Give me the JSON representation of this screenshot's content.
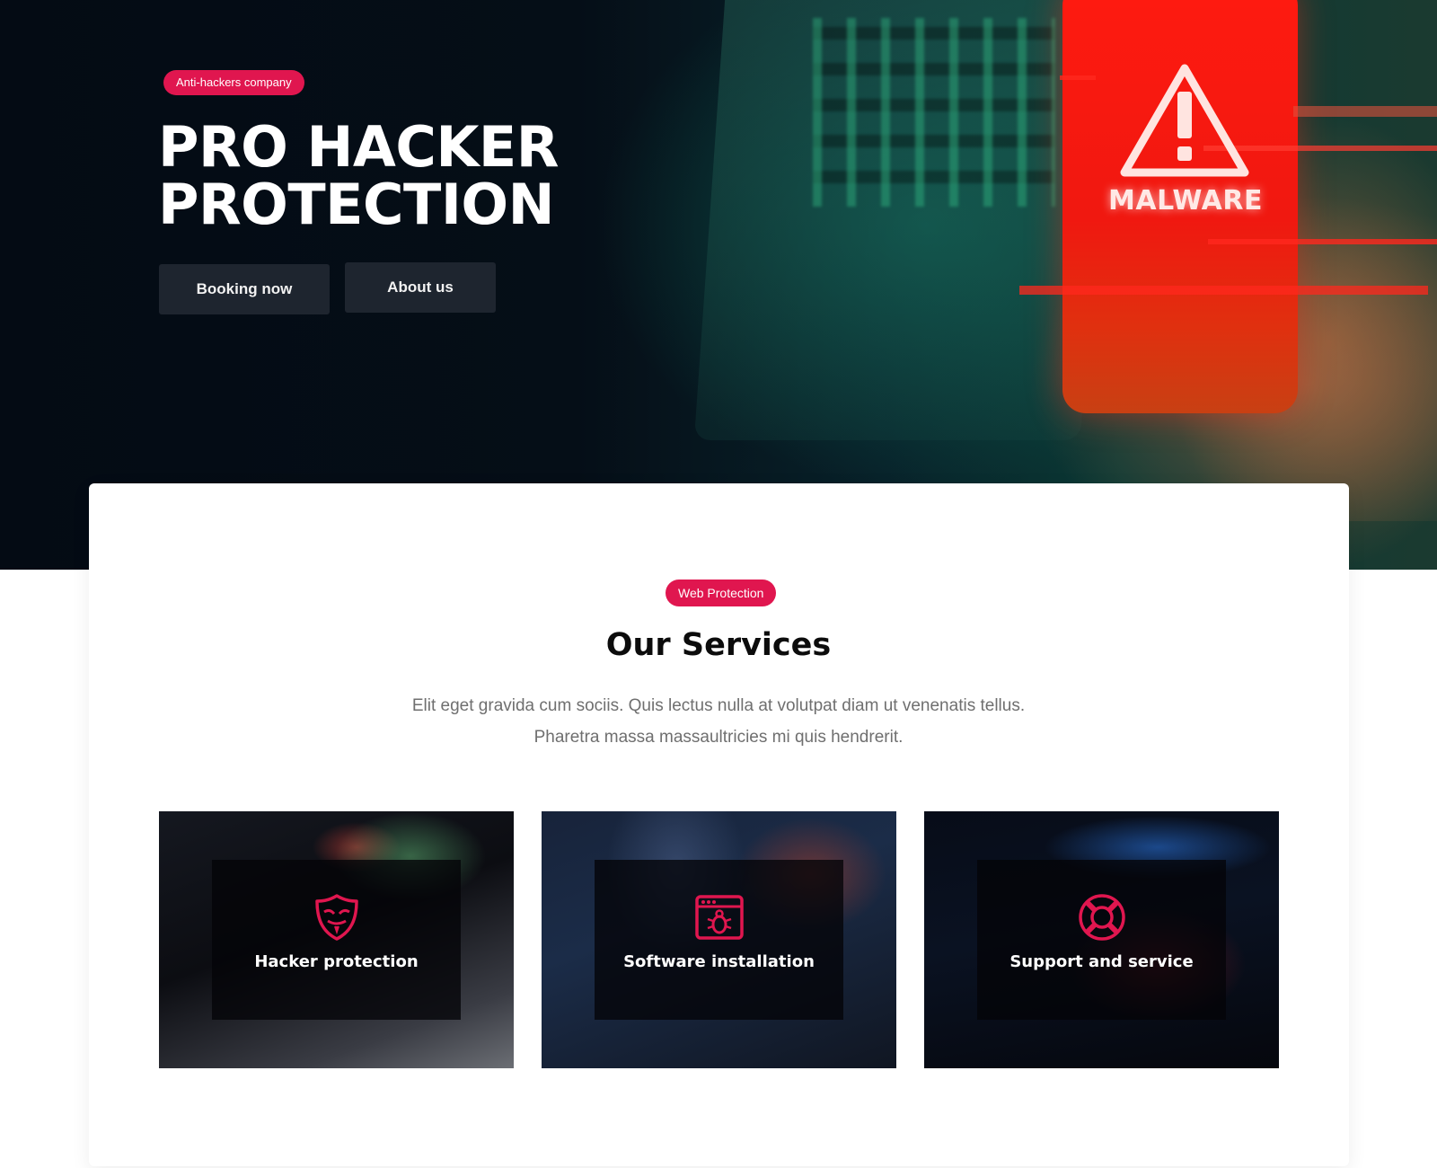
{
  "colors": {
    "accent": "#e0164f",
    "hero_bg": "#040b14",
    "button_bg": "#1e252f",
    "text_dark": "#0c0c0c",
    "text_muted": "#6f6f6f"
  },
  "hero": {
    "badge": "Anti-hackers company",
    "title_line1": "PRO HACKER",
    "title_line2": "PROTECTION",
    "buttons": {
      "booking": "Booking now",
      "about": "About us"
    },
    "image_text": "MALWARE"
  },
  "services": {
    "badge": "Web Protection",
    "title": "Our Services",
    "description_line1": "Elit eget gravida cum sociis. Quis lectus nulla at volutpat diam ut venenatis tellus.",
    "description_line2": "Pharetra massa massaultricies mi quis hendrerit.",
    "cards": [
      {
        "label": "Hacker protection",
        "icon": "mask-shield-icon"
      },
      {
        "label": "Software installation",
        "icon": "bug-window-icon"
      },
      {
        "label": "Support and service",
        "icon": "lifebuoy-icon"
      }
    ]
  }
}
